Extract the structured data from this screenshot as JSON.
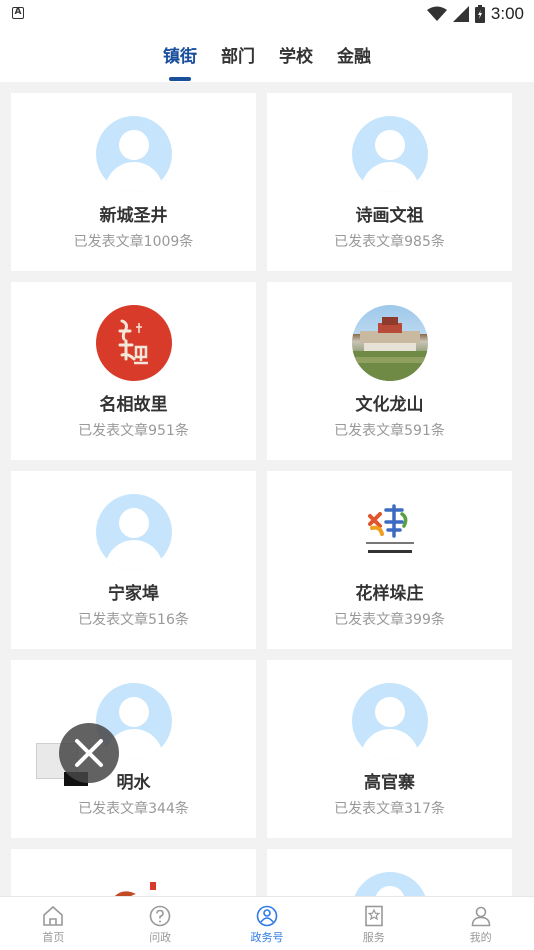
{
  "status": {
    "time": "3:00",
    "left_icon": "A"
  },
  "tabs": [
    {
      "label": "镇街",
      "active": true
    },
    {
      "label": "部门",
      "active": false
    },
    {
      "label": "学校",
      "active": false
    },
    {
      "label": "金融",
      "active": false
    }
  ],
  "cards": [
    {
      "name": "新城圣井",
      "count": "已发表文章1009条",
      "avatar": "default-avatar"
    },
    {
      "name": "诗画文祖",
      "count": "已发表文章985条",
      "avatar": "default-avatar"
    },
    {
      "name": "名相故里",
      "count": "已发表文章951条",
      "avatar": "red-calligraphy-logo",
      "logo_text": "名相故里"
    },
    {
      "name": "文化龙山",
      "count": "已发表文章591条",
      "avatar": "building-photo"
    },
    {
      "name": "宁家埠",
      "count": "已发表文章516条",
      "avatar": "default-avatar"
    },
    {
      "name": "花样垛庄",
      "count": "已发表文章399条",
      "avatar": "flower-logo",
      "logo_text": "花样垛庄"
    },
    {
      "name": "明水",
      "count": "已发表文章344条",
      "avatar": "default-avatar"
    },
    {
      "name": "高官寨",
      "count": "已发表文章317条",
      "avatar": "default-avatar"
    }
  ],
  "bottom_nav": [
    {
      "label": "首页",
      "icon": "home-icon",
      "active": false
    },
    {
      "label": "问政",
      "icon": "question-icon",
      "active": false
    },
    {
      "label": "政务号",
      "icon": "gov-account-icon",
      "active": true
    },
    {
      "label": "服务",
      "icon": "service-icon",
      "active": false
    },
    {
      "label": "我的",
      "icon": "profile-icon",
      "active": false
    }
  ],
  "colors": {
    "accent": "#1a4f9c",
    "nav_active": "#2f7ae5",
    "avatar_bg": "#c6e5fc",
    "muted": "#999999"
  }
}
